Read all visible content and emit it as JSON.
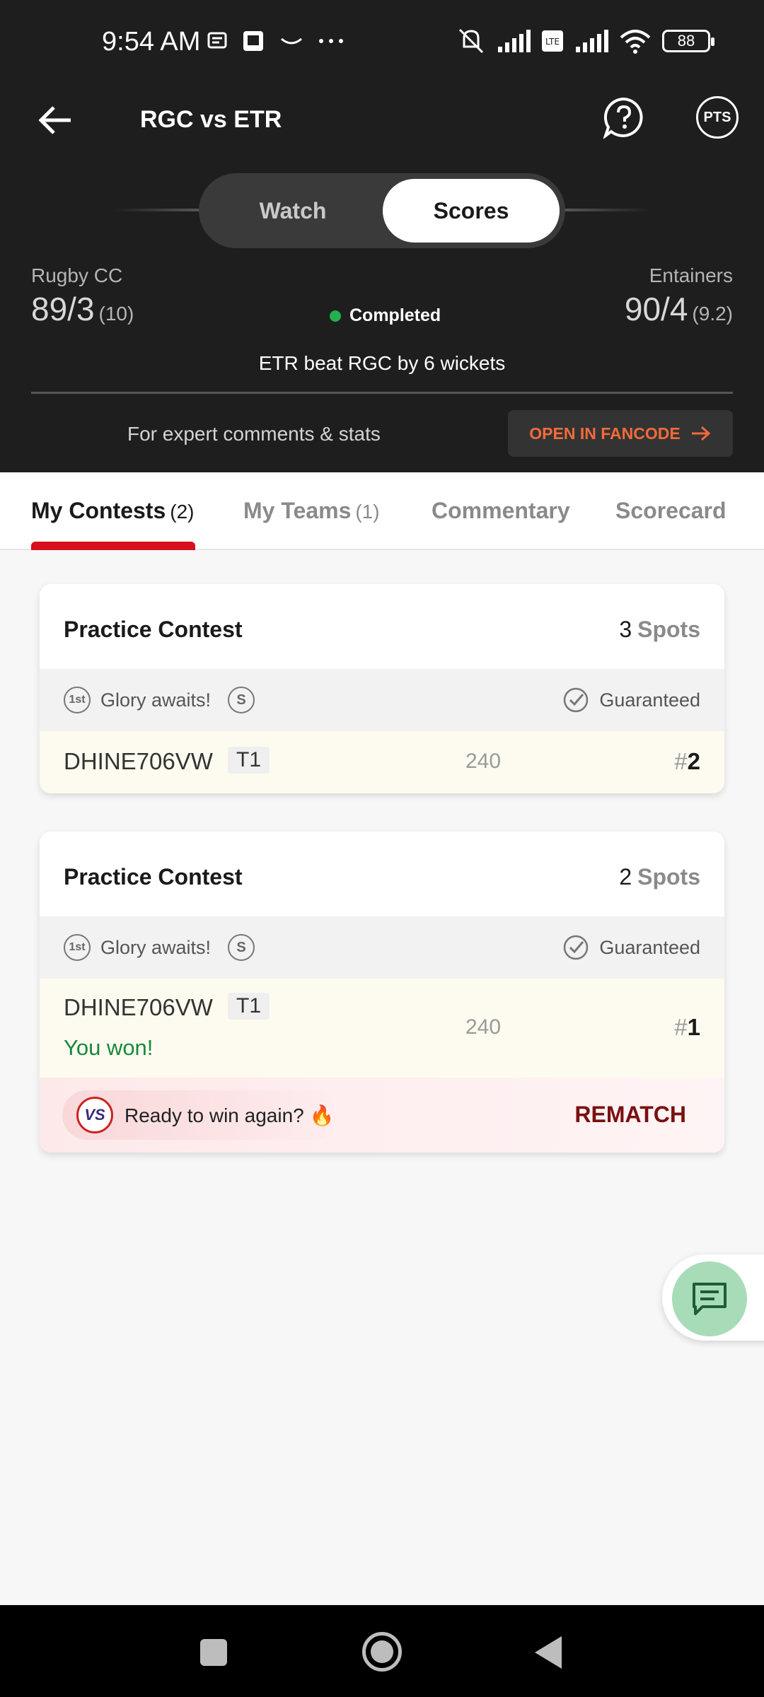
{
  "status_bar": {
    "time": "9:54 AM",
    "battery": "88"
  },
  "header": {
    "title": "RGC vs ETR",
    "toggle": {
      "watch": "Watch",
      "scores": "Scores"
    },
    "team_left": {
      "name": "Rugby CC",
      "score": "89/3",
      "overs": "(10)"
    },
    "team_right": {
      "name": "Entainers",
      "score": "90/4",
      "overs": "(9.2)"
    },
    "match_status": "Completed",
    "result": "ETR beat RGC by 6 wickets",
    "expert_text": "For expert comments & stats",
    "fancode_button": "OPEN IN FANCODE",
    "pts_label": "PTS"
  },
  "tabs": [
    {
      "label": "My Contests",
      "count": "(2)"
    },
    {
      "label": "My Teams",
      "count": "(1)"
    },
    {
      "label": "Commentary",
      "count": ""
    },
    {
      "label": "Scorecard",
      "count": ""
    }
  ],
  "contests": [
    {
      "title": "Practice Contest",
      "spots_count": "3",
      "spots_label": "Spots",
      "first_label": "1st",
      "glory": "Glory awaits!",
      "s_label": "S",
      "guaranteed": "Guaranteed",
      "team": "DHINE706VW",
      "team_tag": "T1",
      "points": "240",
      "rank_hash": "#",
      "rank": "2"
    },
    {
      "title": "Practice Contest",
      "spots_count": "2",
      "spots_label": "Spots",
      "first_label": "1st",
      "glory": "Glory awaits!",
      "s_label": "S",
      "guaranteed": "Guaranteed",
      "team": "DHINE706VW",
      "team_tag": "T1",
      "points": "240",
      "rank_hash": "#",
      "rank": "1",
      "won_text": "You won!",
      "rematch_prompt": "Ready to win again? 🔥",
      "rematch_button": "REMATCH",
      "vs_label": "VS"
    }
  ],
  "colors": {
    "accent_red": "#d7101e",
    "fancode_orange": "#f26b3a",
    "win_green": "#19883a",
    "live_dot": "#22b14c"
  }
}
